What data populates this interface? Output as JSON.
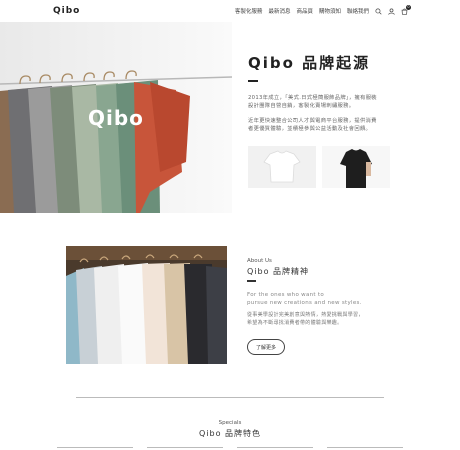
{
  "header": {
    "logo": "Qibo",
    "nav": [
      "客製化服務",
      "最新消息",
      "商品頁",
      "購物須知",
      "聯絡我們"
    ],
    "icons": [
      "search-icon",
      "user-icon",
      "cart-icon"
    ],
    "cart_count": "0"
  },
  "hero": {
    "image_word": "Qibo",
    "title": "Qibo 品牌起源",
    "para1_line1": "2013年成立，「美式.日式極簡服飾品牌」，擁有服裝",
    "para1_line2": "設計團隊自營自銷，客製化賣場刺繡服務。",
    "para2_line1": "近年更快速整合公司人才與電商平台服務，提供消費",
    "para2_line2": "者更優質體驗，並積極參與公益活動及社會回饋。"
  },
  "about": {
    "label_en": "About Us",
    "title": "Qibo 品牌精神",
    "quote_line1": "For the ones who want to",
    "quote_line2": "pursue new creations and new styles.",
    "para_line1": "從事美學設計完美創意與熱情，熱愛挑戰與學習，",
    "para_line2": "希望為不斷尋找消費者帶的體驗與樂趣。",
    "button": "了解更多"
  },
  "specials": {
    "label_en": "Specials",
    "title": "Qibo 品牌特色"
  },
  "colors": {
    "text": "#222222",
    "muted": "#777777",
    "divider": "#bbbbbb"
  }
}
